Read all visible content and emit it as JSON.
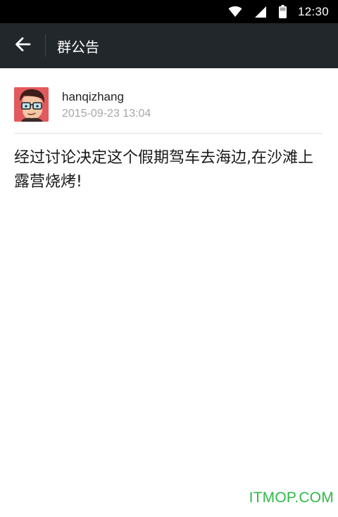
{
  "status_bar": {
    "time": "12:30",
    "icons": [
      "wifi-icon",
      "signal-icon",
      "battery-icon"
    ]
  },
  "action_bar": {
    "back_icon": "arrow-left-icon",
    "title": "群公告"
  },
  "announcement": {
    "author": "hanqizhang",
    "timestamp": "2015-09-23 13:04",
    "body": "经过讨论决定这个假期驾车去海边,在沙滩上露营烧烤!"
  },
  "watermark": "ITMOP.COM",
  "colors": {
    "status_bar_bg": "#000000",
    "action_bar_bg": "#22272b",
    "timestamp_text": "#a7a7a7",
    "watermark_text": "#2fb94a"
  }
}
